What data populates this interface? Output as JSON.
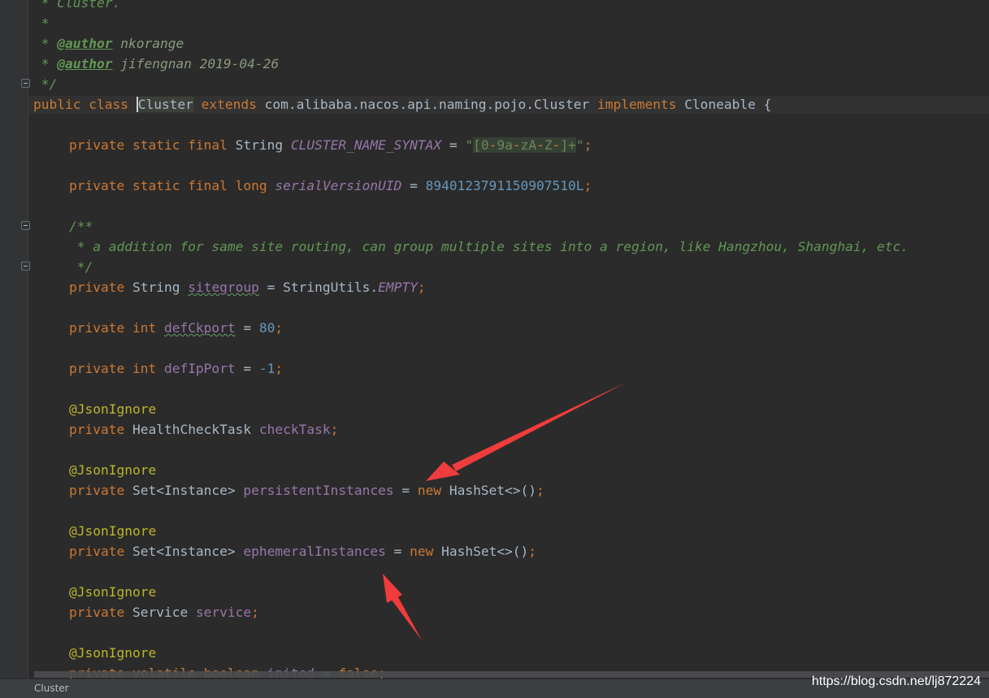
{
  "editor": {
    "lines": {
      "doc_cluster": " * Cluster.",
      "doc_star": " *",
      "doc_author1_prefix": " * ",
      "doc_author_tag": "@author",
      "doc_author1_name": " nkorange",
      "doc_author2_prefix": " * ",
      "doc_author2_name": " jifengnan 2019-04-26",
      "doc_end": " */",
      "class_kw1": "public class ",
      "class_name": "Cluster",
      "class_extends": " extends ",
      "class_super": "com.alibaba.nacos.api.naming.pojo.Cluster",
      "class_implements": " implements ",
      "class_iface": "Cloneable {",
      "f1_mods": "private static final ",
      "f1_type": "String ",
      "f1_name": "CLUSTER_NAME_SYNTAX",
      "f1_eq": " = ",
      "f1_q1": "\"",
      "f1_regex_a": "[0",
      "f1_regex_dash1": "-",
      "f1_regex_b": "9a",
      "f1_regex_dash2": "-",
      "f1_regex_c": "zA",
      "f1_regex_dash3": "-",
      "f1_regex_d": "Z",
      "f1_regex_dash4": "-",
      "f1_regex_e": "]+",
      "f1_q2": "\"",
      "f1_semi": ";",
      "f2_mods": "private static final long ",
      "f2_name": "serialVersionUID",
      "f2_eq": " = ",
      "f2_val": "8940123791150907510L",
      "f2_semi": ";",
      "jd_open": "/**",
      "jd_body": " * a addition for same site routing, can group multiple sites into a region, like Hangzhou, Shanghai, etc.",
      "jd_close": " */",
      "f3_mods": "private ",
      "f3_type": "String ",
      "f3_name": "sitegroup",
      "f3_eq": " = StringUtils.",
      "f3_val": "EMPTY",
      "f3_semi": ";",
      "f4_mods": "private int ",
      "f4_name": "defCkport",
      "f4_eq": " = ",
      "f4_val": "80",
      "f4_semi": ";",
      "f5_mods": "private int ",
      "f5_name": "defIpPort",
      "f5_eq": " = ",
      "f5_val": "-1",
      "f5_semi": ";",
      "annotation": "@JsonIgnore",
      "f6_mods": "private ",
      "f6_type": "HealthCheckTask ",
      "f6_name": "checkTask",
      "f6_semi": ";",
      "f7_mods": "private ",
      "f7_type": "Set<Instance> ",
      "f7_name": "persistentInstances",
      "f7_eq": " = ",
      "f7_new": "new ",
      "f7_init": "HashSet<>()",
      "f7_semi": ";",
      "f8_mods": "private ",
      "f8_type": "Set<Instance> ",
      "f8_name": "ephemeralInstances",
      "f8_eq": " = ",
      "f8_new": "new ",
      "f8_init": "HashSet<>()",
      "f8_semi": ";",
      "f9_mods": "private ",
      "f9_type": "Service ",
      "f9_name": "service",
      "f9_semi": ";",
      "f10_mods": "private volatile boolean ",
      "f10_name": "inited",
      "f10_eq": " = ",
      "f10_val": "false",
      "f10_semi": ";"
    }
  },
  "statusbar": {
    "breadcrumb": "Cluster"
  },
  "watermark": "https://blog.csdn.net/lj872224",
  "colors": {
    "background": "#2b2b2b",
    "keyword": "#cc7832",
    "comment": "#629755",
    "field": "#9876aa",
    "number": "#6897bb",
    "string": "#6a8759",
    "annotation": "#bbb529",
    "arrow": "#f03c3c"
  },
  "icons": [
    "fold-marker-icon",
    "annotation-arrow-icon"
  ]
}
